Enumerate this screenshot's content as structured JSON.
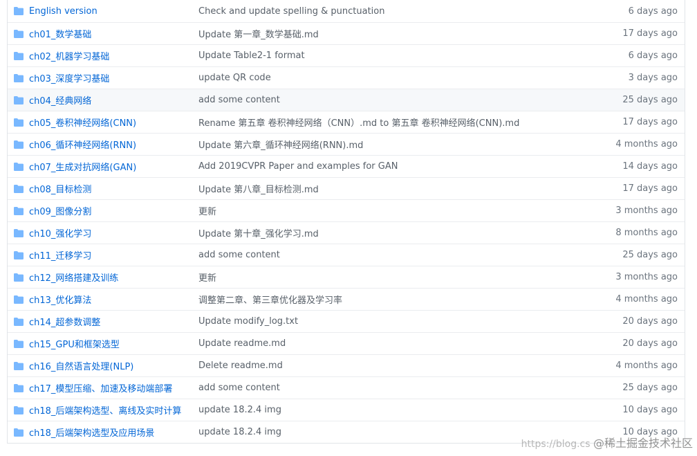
{
  "colors": {
    "link": "#0366d6",
    "folder_icon": "#79b8ff",
    "text_muted": "#586069",
    "age": "#6a737d",
    "border": "#eaecef",
    "hover_row": "#f6f8fa"
  },
  "rows": [
    {
      "name": "English version",
      "message": "Check and update spelling & punctuation",
      "age": "6 days ago"
    },
    {
      "name": "ch01_数学基础",
      "message": "Update 第一章_数学基础.md",
      "age": "17 days ago"
    },
    {
      "name": "ch02_机器学习基础",
      "message": "Update Table2-1 format",
      "age": "6 days ago"
    },
    {
      "name": "ch03_深度学习基础",
      "message": "update QR code",
      "age": "3 days ago"
    },
    {
      "name": "ch04_经典网络",
      "message": "add some content",
      "age": "25 days ago"
    },
    {
      "name": "ch05_卷积神经网络(CNN)",
      "message": "Rename 第五章 卷积神经网络（CNN）.md to 第五章 卷积神经网络(CNN).md",
      "age": "17 days ago"
    },
    {
      "name": "ch06_循环神经网络(RNN)",
      "message": "Update 第六章_循环神经网络(RNN).md",
      "age": "4 months ago"
    },
    {
      "name": "ch07_生成对抗网络(GAN)",
      "message": "Add 2019CVPR Paper and examples for GAN",
      "age": "14 days ago"
    },
    {
      "name": "ch08_目标检测",
      "message": "Update 第八章_目标检测.md",
      "age": "17 days ago"
    },
    {
      "name": "ch09_图像分割",
      "message": "更新",
      "age": "3 months ago"
    },
    {
      "name": "ch10_强化学习",
      "message": "Update 第十章_强化学习.md",
      "age": "8 months ago"
    },
    {
      "name": "ch11_迁移学习",
      "message": "add some content",
      "age": "25 days ago"
    },
    {
      "name": "ch12_网络搭建及训练",
      "message": "更新",
      "age": "3 months ago"
    },
    {
      "name": "ch13_优化算法",
      "message": "调整第二章、第三章优化器及学习率",
      "age": "4 months ago"
    },
    {
      "name": "ch14_超参数调整",
      "message": "Update modify_log.txt",
      "age": "20 days ago"
    },
    {
      "name": "ch15_GPU和框架选型",
      "message": "Update readme.md",
      "age": "20 days ago"
    },
    {
      "name": "ch16_自然语言处理(NLP)",
      "message": "Delete readme.md",
      "age": "4 months ago"
    },
    {
      "name": "ch17_模型压缩、加速及移动端部署",
      "message": "add some content",
      "age": "25 days ago"
    },
    {
      "name": "ch18_后端架构选型、离线及实时计算",
      "message": "update 18.2.4 img",
      "age": "10 days ago"
    },
    {
      "name": "ch18_后端架构选型及应用场景",
      "message": "update 18.2.4 img",
      "age": "10 days ago"
    }
  ],
  "hover_row_index": 4,
  "watermark": {
    "url": "https://blog.cs",
    "label": "@稀土掘金技术社区"
  }
}
